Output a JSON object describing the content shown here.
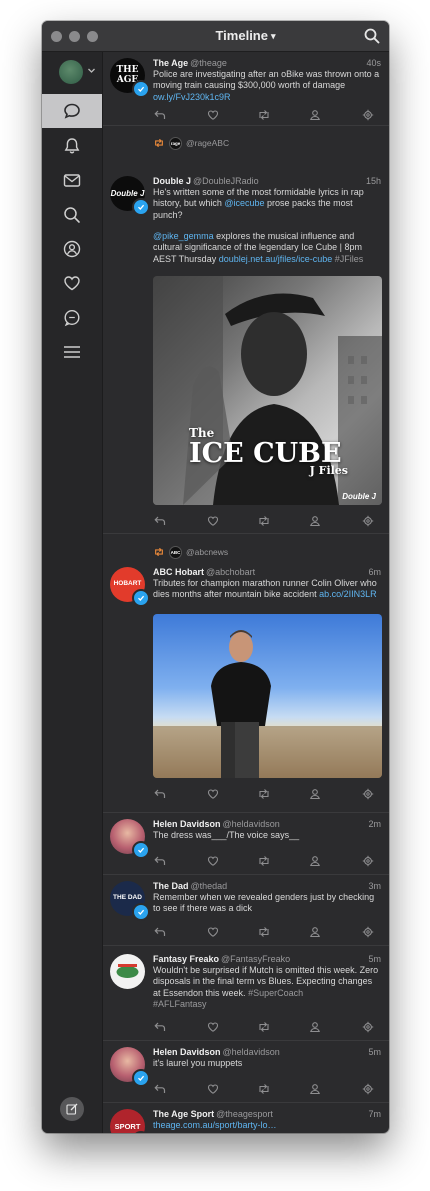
{
  "titlebar": {
    "title": "Timeline"
  },
  "sidebar": {
    "items": [
      "Home timeline",
      "Notifications",
      "Messages",
      "Search",
      "Profile",
      "Likes",
      "Direct messages",
      "Menu"
    ]
  },
  "tweets": [
    {
      "name": "The Age",
      "handle": "@theage",
      "time": "40s",
      "text": "Police are investigating after an oBike was thrown onto a moving train causing $300,000 worth of damage ",
      "link": "ow.ly/FvJ230k1c9R",
      "avatar_text": "THE AGE"
    },
    {
      "retweeted_by": "@rageABC",
      "retweeter_icon": "rage",
      "name": "Double J",
      "handle": "@DoubleJRadio",
      "time": "15h",
      "text1_a": "He's written some of the most formidable lyrics in rap history, but which ",
      "text1_link": "@icecube",
      "text1_b": " prose packs the most punch?",
      "text2_link_a": "@pike_gemma",
      "text2_a": " explores the musical influence and cultural significance of the legendary Ice Cube | 8pm AEST Thursday ",
      "text2_link_b": "doublej.net.au/jfiles/ice-cube",
      "text2_space": " ",
      "text2_hashtag": "#JFiles",
      "avatar_text": "Double J",
      "media": {
        "the": "The",
        "title": "ICE CUBE",
        "sub": "J Files",
        "logo": "Double J"
      }
    },
    {
      "retweeted_by": "@abcnews",
      "retweeter_icon": "ABC",
      "name": "ABC Hobart",
      "handle": "@abchobart",
      "time": "6m",
      "text": "Tributes for champion marathon runner Colin Oliver who dies months after mountain bike accident ",
      "link": "ab.co/2IIN3LR",
      "avatar_text": "HOBART"
    },
    {
      "name": "Helen Davidson",
      "handle": "@heldavidson",
      "time": "2m",
      "text": "The dress was___/The voice says__"
    },
    {
      "name": "The Dad",
      "handle": "@thedad",
      "time": "3m",
      "text": "Remember when we revealed genders just by checking to see if there was a dick",
      "avatar_text": "THE DAD"
    },
    {
      "name": "Fantasy Freako",
      "handle": "@FantasyFreako",
      "time": "5m",
      "text": "Wouldn't be surprised if Mutch is omitted this week. Zero disposals in the final term vs Blues. Expecting changes at Essendon this week. ",
      "hashtag1": "#SuperCoach",
      "hashtag2": "#AFLFantasy"
    },
    {
      "name": "Helen Davidson",
      "handle": "@heldavidson",
      "time": "5m",
      "text": "it's laurel you muppets"
    },
    {
      "name": "The Age Sport",
      "handle": "@theagesport",
      "time": "7m",
      "link": "theage.com.au/sport/barty-lo…",
      "avatar_text": "SPORT"
    }
  ],
  "colors": {
    "accent": "#2aa3ef",
    "link": "#5fb5f0",
    "background": "#2b2b2d",
    "sidebar": "#262628",
    "retweet": "#e8883a"
  }
}
